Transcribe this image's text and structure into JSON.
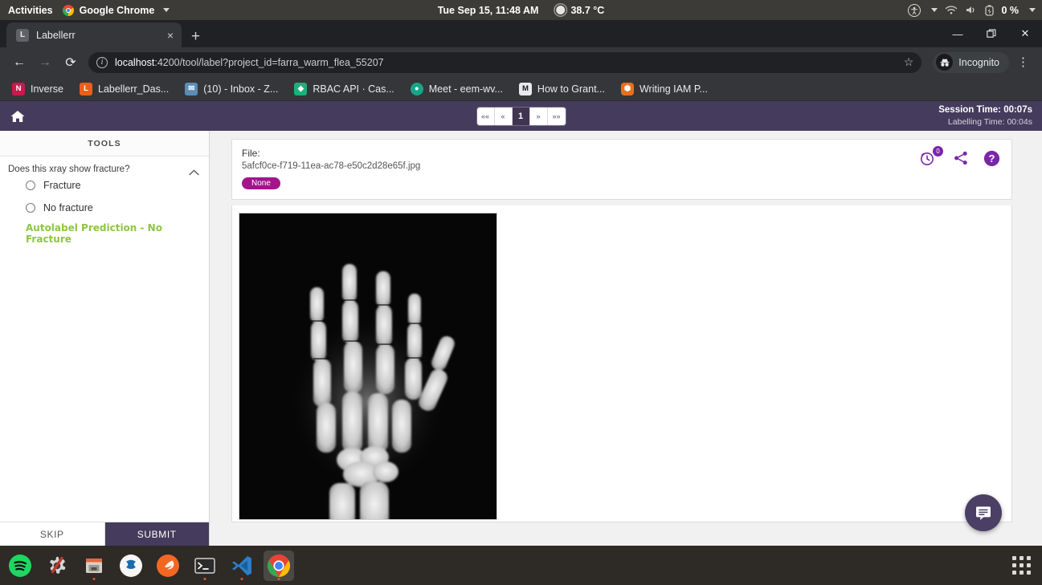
{
  "os_topbar": {
    "activities": "Activities",
    "app_name": "Google Chrome",
    "datetime": "Tue Sep 15, 11:48 AM",
    "temperature": "38.7 °C",
    "battery": "0 %",
    "icons": [
      "accessibility-icon",
      "wifi-icon",
      "volume-icon",
      "battery-icon"
    ]
  },
  "browser": {
    "tab": {
      "title": "Labellerr",
      "favicon_letter": "L",
      "close_label": "×"
    },
    "new_tab_label": "+",
    "window_controls": {
      "minimize": "—",
      "restore": "❐",
      "close": "✕"
    },
    "nav": {
      "back": "←",
      "forward": "→",
      "reload": "⟳"
    },
    "omnibox": {
      "host": "localhost",
      "path": ":4200/tool/label?project_id=farra_warm_flea_55207",
      "full_url": "localhost:4200/tool/label?project_id=farra_warm_flea_55207",
      "star": "☆"
    },
    "profile": {
      "label": "Incognito"
    },
    "menu_label": "⋮",
    "bookmarks": [
      {
        "label": "Inverse",
        "letter": "N",
        "color": "#c81a4b"
      },
      {
        "label": "Labellerr_Das...",
        "letter": "L",
        "color": "#e8601c"
      },
      {
        "label": "(10) - Inbox - Z...",
        "letter": "✉",
        "color": "#5a8db8"
      },
      {
        "label": "RBAC API · Cas...",
        "letter": "◆",
        "color": "#1cb07a"
      },
      {
        "label": "Meet - eem-wv...",
        "letter": "●",
        "color": "#17a589"
      },
      {
        "label": "How to Grant...",
        "letter": "M",
        "color": "#1a1a1a"
      },
      {
        "label": "Writing IAM P...",
        "letter": "⬢",
        "color": "#e8701c"
      }
    ]
  },
  "app": {
    "header": {
      "home_icon": "home-icon",
      "pagination": {
        "first": "««",
        "prev": "«",
        "current": "1",
        "next": "»",
        "last": "»»"
      },
      "session_time": "Session Time: 00:07s",
      "labelling_time": "Labelling Time: 00:04s"
    },
    "tools": {
      "title": "TOOLS",
      "question": "Does this xray show fracture?",
      "collapse_icon": "chevron-up-icon",
      "options": [
        {
          "label": "Fracture",
          "selected": false
        },
        {
          "label": "No fracture",
          "selected": false
        }
      ],
      "autolabel_prediction": "Autolabel Prediction - No Fracture",
      "autolabel_color": "#8dc63f",
      "skip_label": "SKIP",
      "submit_label": "SUBMIT",
      "submit_color": "#453b5c"
    },
    "file_card": {
      "file_label": "File:",
      "file_name": "5afcf0ce-f719-11ea-ac78-e50c2d28e65f.jpg",
      "tag": "None",
      "tag_color": "#a4138e",
      "icons": [
        {
          "name": "history-icon",
          "badge": "0"
        },
        {
          "name": "share-icon",
          "badge": ""
        },
        {
          "name": "help-icon",
          "badge": ""
        }
      ]
    },
    "canvas": {
      "image_alt": "hand-xray-image"
    },
    "chat_fab": {
      "icon": "chat-icon"
    }
  },
  "dock": {
    "items": [
      "spotify-icon",
      "settings-icon",
      "files-icon",
      "sublime-icon",
      "firefox-icon",
      "terminal-icon",
      "vscode-icon",
      "chrome-icon"
    ],
    "show_apps": "apps-grid-icon"
  }
}
